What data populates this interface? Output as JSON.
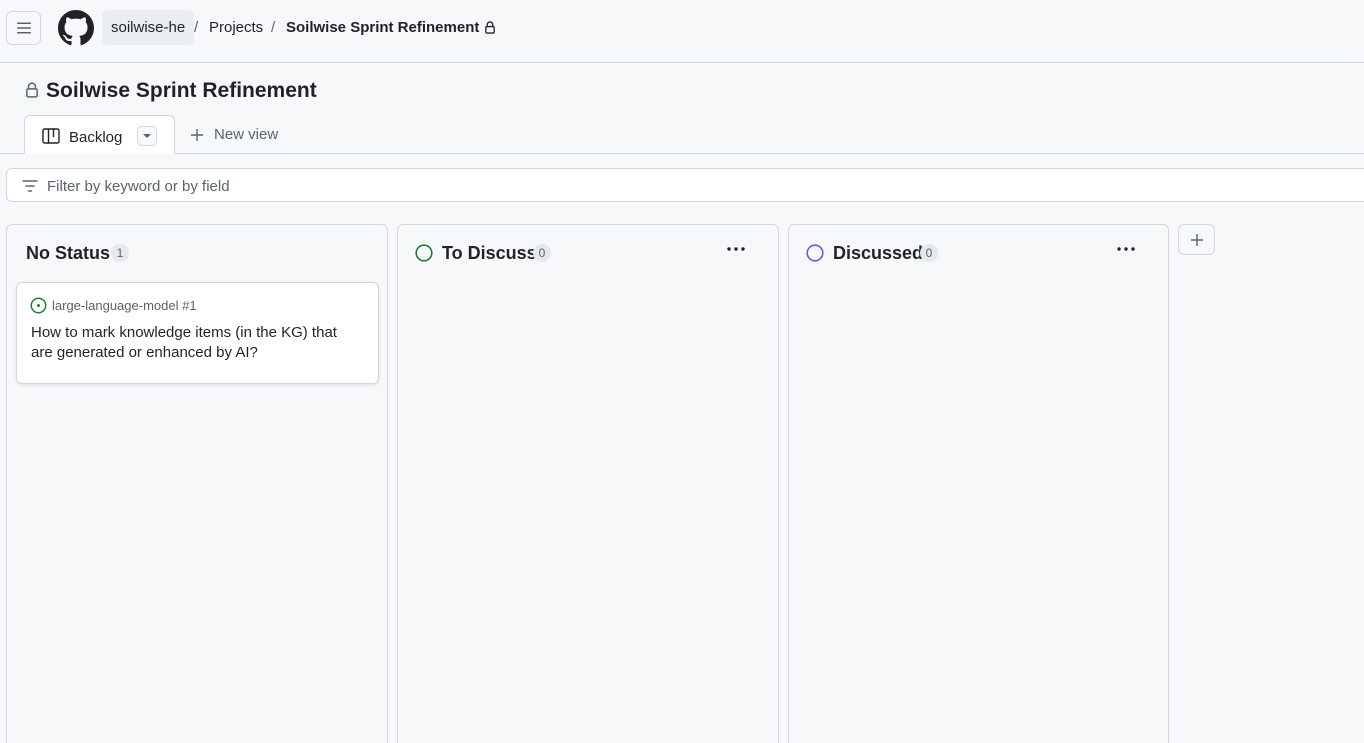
{
  "header": {
    "owner": "soilwise-he",
    "separator": "/",
    "projects": "Projects",
    "current": "Soilwise Sprint Refinement"
  },
  "project": {
    "title": "Soilwise Sprint Refinement"
  },
  "views": {
    "active_tab": "Backlog",
    "new_view": "New view"
  },
  "filter": {
    "placeholder": "Filter by keyword or by field"
  },
  "columns": [
    {
      "title": "No Status",
      "count": "1",
      "cards": [
        {
          "ref": "large-language-model #1",
          "title": "How to mark knowledge items (in the KG) that are generated or enhanced by AI?"
        }
      ]
    },
    {
      "title": "To Discuss",
      "count": "0",
      "status_color": "#1a7f37"
    },
    {
      "title": "Discussed",
      "count": "0",
      "status_color": "#8250df"
    }
  ],
  "icons": {
    "menu": "hamburger-icon",
    "logo": "github-logo-icon",
    "lock": "lock-icon",
    "board": "board-icon",
    "dropdown": "triangle-down-icon",
    "plus": "plus-icon",
    "filter": "filter-icon",
    "issue_open": "issue-opened-icon",
    "kebab": "kebab-horizontal-icon"
  },
  "colors": {
    "issue_open": "#1a7f37",
    "to_discuss": "#1a7f37",
    "discussed": "#8250df"
  }
}
